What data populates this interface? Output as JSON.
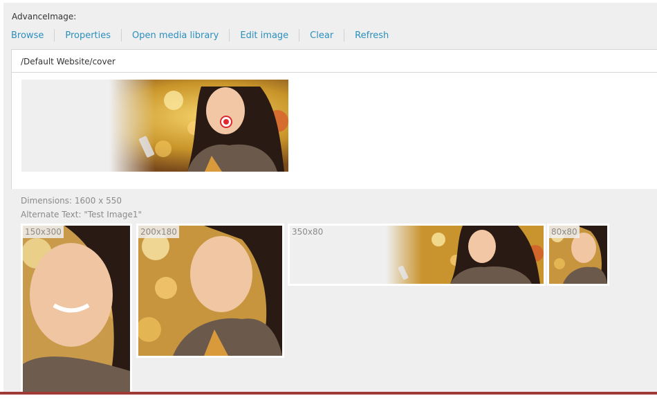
{
  "field": {
    "label": "AdvanceImage:"
  },
  "toolbar": {
    "items": [
      {
        "label": "Browse",
        "name": "browse-button"
      },
      {
        "label": "Properties",
        "name": "properties-button"
      },
      {
        "label": "Open media library",
        "name": "open-media-library-button"
      },
      {
        "label": "Edit image",
        "name": "edit-image-button"
      },
      {
        "label": "Clear",
        "name": "clear-button"
      },
      {
        "label": "Refresh",
        "name": "refresh-button"
      }
    ],
    "link_color": "#2a8fbd"
  },
  "path": {
    "value": "/Default Website/cover"
  },
  "info": {
    "dimensions": "Dimensions: 1600 x 550",
    "alt_text": "Alternate Text: \"Test Image1\""
  },
  "thumbnails": [
    {
      "label": "150x300"
    },
    {
      "label": "200x180"
    },
    {
      "label": "350x80"
    },
    {
      "label": "80x80"
    }
  ],
  "colors": {
    "panel_bg": "#efefef",
    "accent_bar": "#a03a36",
    "focus_marker": "#e0282e"
  }
}
